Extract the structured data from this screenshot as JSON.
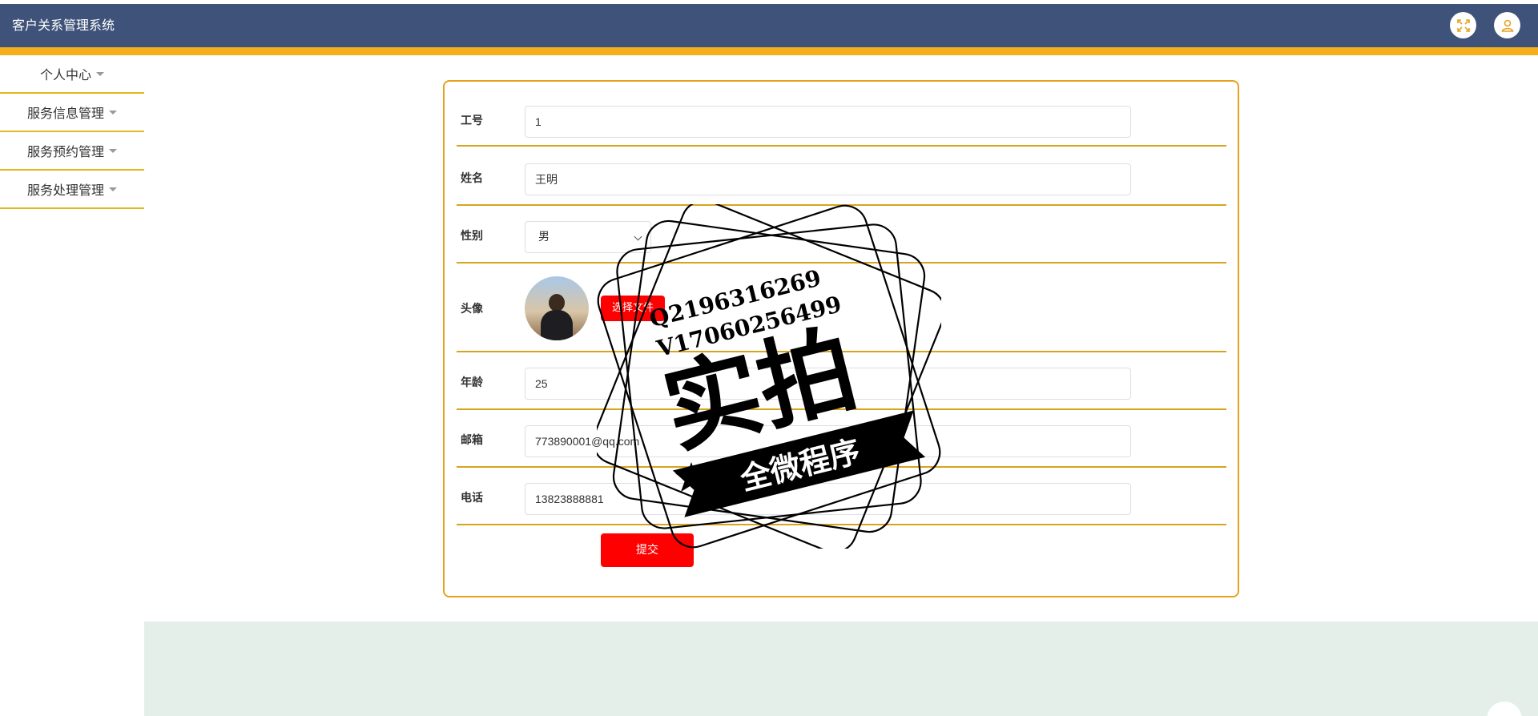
{
  "header": {
    "title": "客户关系管理系统",
    "icons": [
      "fullscreen-icon",
      "user-icon"
    ]
  },
  "sidebar": {
    "items": [
      {
        "label": "个人中心"
      },
      {
        "label": "服务信息管理"
      },
      {
        "label": "服务预约管理"
      },
      {
        "label": "服务处理管理"
      }
    ]
  },
  "form": {
    "fields": {
      "job_no": {
        "label": "工号",
        "value": "1"
      },
      "name": {
        "label": "姓名",
        "value": "王明"
      },
      "gender": {
        "label": "性别",
        "value": "男"
      },
      "avatar": {
        "label": "头像",
        "upload_label": "选择文件"
      },
      "age": {
        "label": "年龄",
        "value": "25"
      },
      "email": {
        "label": "邮箱",
        "value": "773890001@qq.com"
      },
      "phone": {
        "label": "电话",
        "value": "13823888881"
      }
    },
    "submit_label": "提交"
  },
  "watermark": {
    "line1": "Q2196316269",
    "line2": "V17060256499",
    "big": "实拍",
    "ribbon": "全微程序"
  },
  "colors": {
    "header_bg": "#3f5279",
    "accent": "#f3b01a",
    "primary_button": "#ff0000",
    "card_border": "#e7a11f",
    "footer_bg": "#e5efea"
  }
}
